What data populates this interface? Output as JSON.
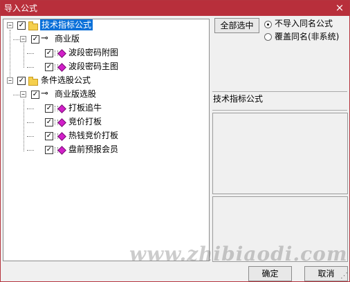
{
  "window": {
    "title": "导入公式",
    "close_icon": "close-icon",
    "colors": {
      "title_bar": "#b82f3b",
      "selection": "#0a70d9",
      "diamond": "#d21fc9",
      "folder": "#f5cf4d"
    }
  },
  "tree": {
    "nodes": [
      {
        "label": "技术指标公式",
        "checked": true,
        "expanded": true,
        "selected": true
      },
      {
        "label": "商业版",
        "checked": true,
        "expanded": true
      },
      {
        "label": "波段密码附图",
        "checked": true
      },
      {
        "label": "波段密码主图",
        "checked": true
      },
      {
        "label": "条件选股公式",
        "checked": true,
        "expanded": true
      },
      {
        "label": "商业版选股",
        "checked": true,
        "expanded": true
      },
      {
        "label": "打板追牛",
        "checked": true
      },
      {
        "label": "竞价打板",
        "checked": true
      },
      {
        "label": "热钱竞价打板",
        "checked": true
      },
      {
        "label": "盘前预报会员",
        "checked": true
      }
    ]
  },
  "right_panel": {
    "select_all_label": "全部选中",
    "radio_options": [
      {
        "label": "不导入同名公式",
        "selected": true
      },
      {
        "label": "覆盖同名(非系统)",
        "selected": false
      }
    ],
    "formula_category": "技术指标公式"
  },
  "watermark": "www.zhibiaodi.com",
  "footer": {
    "ok_label": "确定",
    "cancel_label": "取消"
  }
}
